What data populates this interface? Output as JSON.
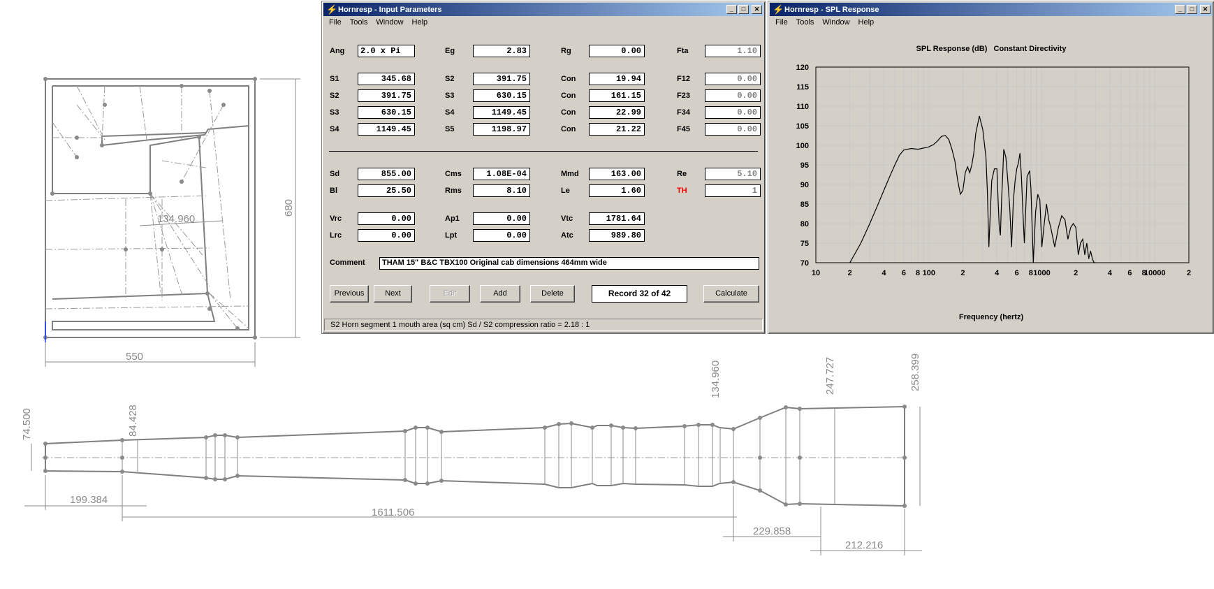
{
  "drawing": {
    "top_view": {
      "dim_width": "550",
      "dim_height": "680",
      "dim_inner": "134.960"
    },
    "side_view": {
      "dims": [
        "74.500",
        "84.428",
        "199.384",
        "1611.506",
        "134.960",
        "247.727",
        "258.399",
        "229.858",
        "212.216"
      ]
    }
  },
  "input_window": {
    "title": "Hornresp - Input Parameters",
    "menu": [
      "File",
      "Tools",
      "Window",
      "Help"
    ],
    "rows": [
      {
        "c1": [
          "Ang",
          "2.0 x Pi"
        ],
        "c2": [
          "Eg",
          "2.83"
        ],
        "c3": [
          "Rg",
          "0.00"
        ],
        "c4": [
          "Fta",
          "1.10"
        ]
      },
      {
        "c1": [
          "S1",
          "345.68"
        ],
        "c2": [
          "S2",
          "391.75"
        ],
        "c3": [
          "Con",
          "19.94"
        ],
        "c4": [
          "F12",
          "0.00"
        ]
      },
      {
        "c1": [
          "S2",
          "391.75"
        ],
        "c2": [
          "S3",
          "630.15"
        ],
        "c3": [
          "Con",
          "161.15"
        ],
        "c4": [
          "F23",
          "0.00"
        ]
      },
      {
        "c1": [
          "S3",
          "630.15"
        ],
        "c2": [
          "S4",
          "1149.45"
        ],
        "c3": [
          "Con",
          "22.99"
        ],
        "c4": [
          "F34",
          "0.00"
        ]
      },
      {
        "c1": [
          "S4",
          "1149.45"
        ],
        "c2": [
          "S5",
          "1198.97"
        ],
        "c3": [
          "Con",
          "21.22"
        ],
        "c4": [
          "F45",
          "0.00"
        ]
      },
      {
        "c1": [
          "Sd",
          "855.00"
        ],
        "c2": [
          "Cms",
          "1.08E-04"
        ],
        "c3": [
          "Mmd",
          "163.00"
        ],
        "c4": [
          "Re",
          "5.10"
        ]
      },
      {
        "c1": [
          "Bl",
          "25.50"
        ],
        "c2": [
          "Rms",
          "8.10"
        ],
        "c3": [
          "Le",
          "1.60"
        ],
        "c4": [
          "TH",
          "1"
        ]
      },
      {
        "c1": [
          "Vrc",
          "0.00"
        ],
        "c2": [
          "Ap1",
          "0.00"
        ],
        "c3": [
          "Vtc",
          "1781.64"
        ]
      },
      {
        "c1": [
          "Lrc",
          "0.00"
        ],
        "c2": [
          "Lpt",
          "0.00"
        ],
        "c3": [
          "Atc",
          "989.80"
        ]
      }
    ],
    "comment_label": "Comment",
    "comment_value": "THAM 15\" B&C TBX100 Original cab dimensions 464mm wide",
    "buttons": {
      "previous": "Previous",
      "next": "Next",
      "edit": "Edit",
      "add": "Add",
      "delete": "Delete",
      "calculate": "Calculate"
    },
    "record": "Record 32 of 42",
    "status": "S2   Horn segment 1 mouth area  (sq cm)   Sd / S2 compression ratio = 2.18 : 1"
  },
  "spl_window": {
    "title": "Hornresp - SPL Response",
    "menu": [
      "File",
      "Tools",
      "Window",
      "Help"
    ],
    "chart_data": {
      "type": "line",
      "title": "SPL Response (dB)   Constant Directivity",
      "xlabel": "Frequency (hertz)",
      "ylabel": "",
      "x_scale": "log",
      "xlim": [
        10,
        20000
      ],
      "ylim": [
        70,
        120
      ],
      "grid": true,
      "y_ticks": [
        120,
        115,
        110,
        105,
        100,
        95,
        90,
        85,
        80,
        75,
        70
      ],
      "x_tick_labels": [
        {
          "f": 10,
          "label": "10"
        },
        {
          "f": 20,
          "label": "2"
        },
        {
          "f": 40,
          "label": "4"
        },
        {
          "f": 60,
          "label": "6"
        },
        {
          "f": 80,
          "label": "8"
        },
        {
          "f": 100,
          "label": "100"
        },
        {
          "f": 200,
          "label": "2"
        },
        {
          "f": 400,
          "label": "4"
        },
        {
          "f": 600,
          "label": "6"
        },
        {
          "f": 800,
          "label": "8"
        },
        {
          "f": 1000,
          "label": "1000"
        },
        {
          "f": 2000,
          "label": "2"
        },
        {
          "f": 4000,
          "label": "4"
        },
        {
          "f": 6000,
          "label": "6"
        },
        {
          "f": 8000,
          "label": "8"
        },
        {
          "f": 10000,
          "label": "10000"
        },
        {
          "f": 20000,
          "label": "2"
        }
      ],
      "series": [
        {
          "x": [
            20,
            25,
            30,
            35,
            40,
            45,
            50,
            55,
            60,
            70,
            80,
            90,
            100,
            110,
            120,
            125,
            130,
            140,
            150,
            160,
            170,
            180,
            190,
            200,
            210,
            220,
            230,
            240,
            250,
            260,
            280,
            300,
            320,
            330,
            340,
            350,
            360,
            380,
            400,
            410,
            420,
            430,
            440,
            450,
            460,
            480,
            500,
            520,
            540,
            560,
            580,
            600,
            620,
            640,
            660,
            680,
            700,
            740,
            780,
            800,
            840,
            880,
            920,
            960,
            1000,
            1050,
            1100,
            1150,
            1200,
            1300,
            1400,
            1500,
            1600,
            1700,
            1800,
            1900,
            2000,
            2100,
            2200,
            2300,
            2400,
            2500,
            2600,
            2700,
            2800,
            2900,
            3000
          ],
          "y": [
            70,
            75,
            80,
            84.5,
            88.5,
            92,
            95,
            97.5,
            98.8,
            99.2,
            99,
            99.3,
            99.6,
            100.2,
            101.2,
            101.8,
            102.3,
            102.5,
            101.5,
            99,
            96,
            91,
            87.5,
            88.5,
            93,
            94.5,
            93,
            95,
            98,
            103,
            107.5,
            104,
            97,
            88,
            74,
            83,
            91,
            94,
            94,
            86,
            79,
            77,
            86,
            92,
            99,
            97,
            91,
            84,
            74,
            86,
            91,
            94,
            95.5,
            98,
            92,
            83,
            75,
            92,
            93.5,
            89,
            70,
            83,
            87.5,
            86,
            74,
            80,
            85,
            81,
            79,
            74,
            79,
            82,
            81,
            76,
            79,
            80,
            79,
            72,
            75,
            76,
            72,
            75,
            71,
            73,
            71,
            70,
            70
          ]
        }
      ]
    }
  }
}
